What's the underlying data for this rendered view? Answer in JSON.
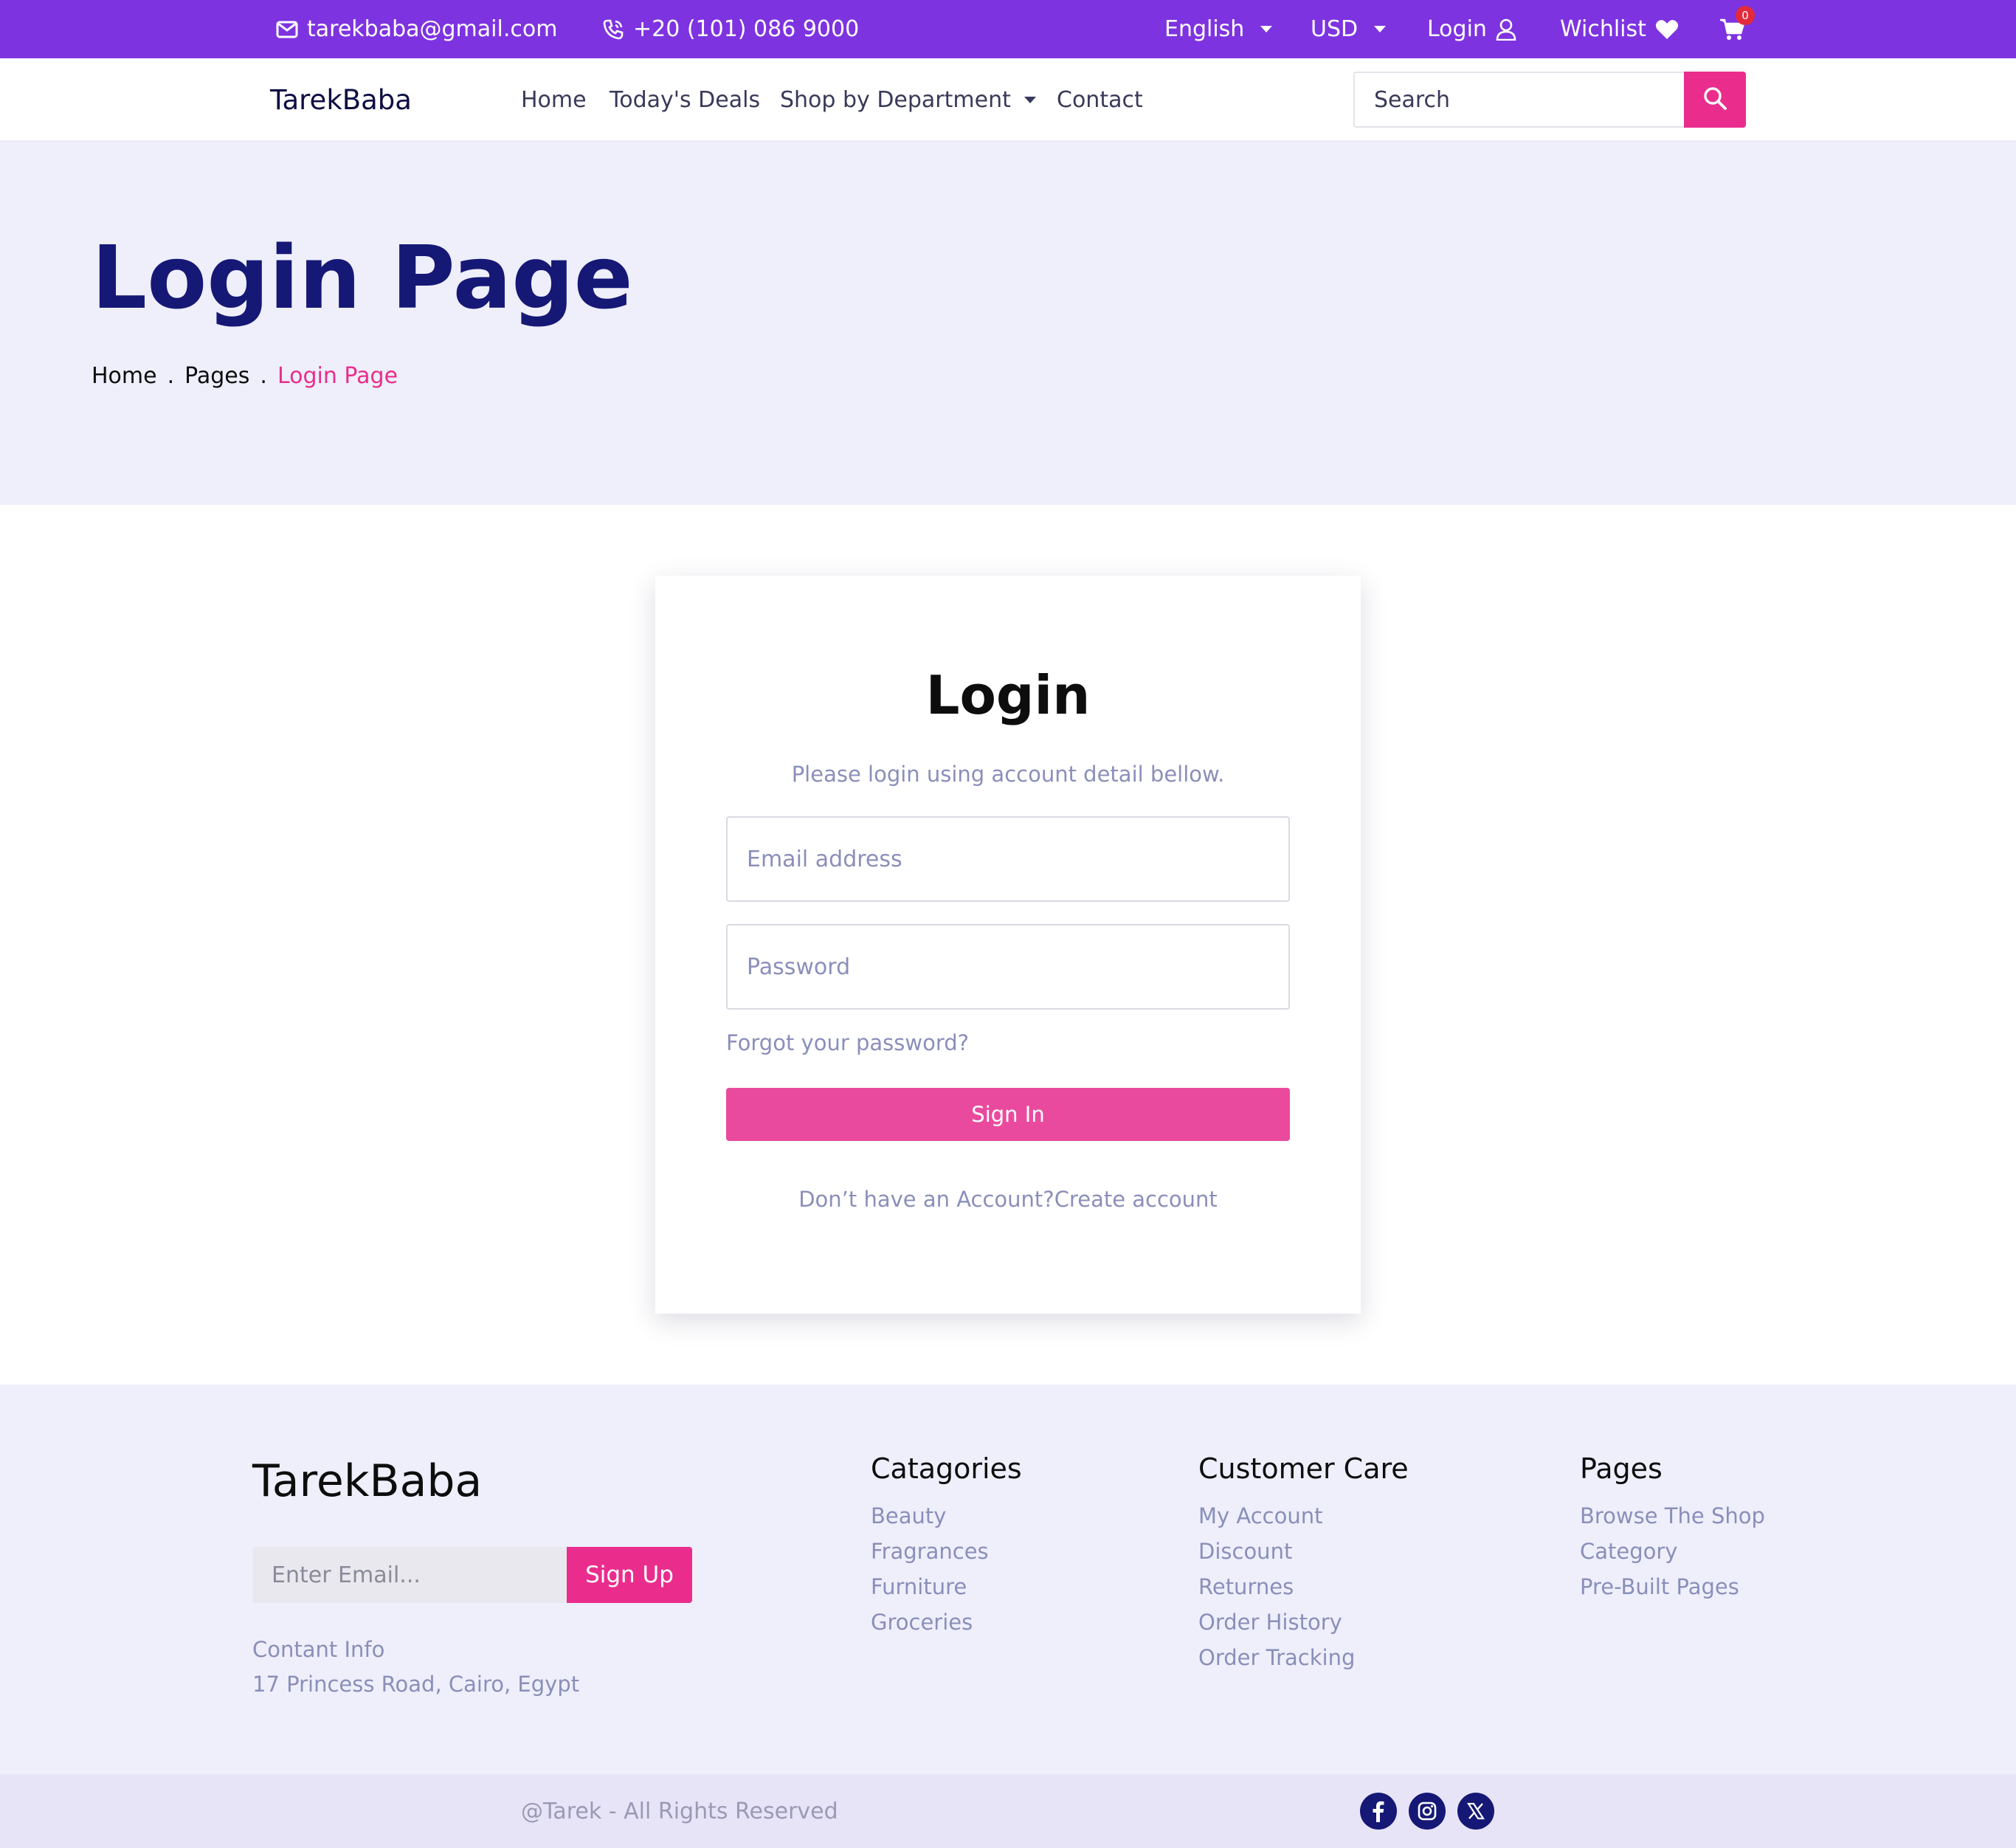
{
  "topbar": {
    "email": "tarekbaba@gmail.com",
    "phone": "+20 (101) 086 9000",
    "language": "English",
    "currency": "USD",
    "login": "Login",
    "wishlist": "Wichlist",
    "cart_count": "0",
    "background": "#7e33e0"
  },
  "nav": {
    "brand": "TarekBaba",
    "links": [
      "Home",
      "Today's Deals",
      "Shop by Department",
      "Contact"
    ],
    "search_placeholder": "Search",
    "accent": "#ea2d8d"
  },
  "hero": {
    "title": "Login Page",
    "breadcrumbs": [
      "Home",
      "Pages",
      "Login Page"
    ],
    "separator": "."
  },
  "login_form": {
    "title": "Login",
    "subtitle": "Please login using account detail bellow.",
    "email_placeholder": "Email address",
    "password_placeholder": "Password",
    "forgot": "Forgot your password?",
    "submit": "Sign In",
    "no_account": "Don’t have an Account?",
    "create": "Create account"
  },
  "footer": {
    "brand": "TarekBaba",
    "newsletter_placeholder": "Enter Email...",
    "newsletter_button": "Sign Up",
    "contact_label": "Contant Info",
    "address": "17 Princess Road, Cairo, Egypt",
    "columns": [
      {
        "heading": "Catagories",
        "links": [
          "Beauty",
          "Fragrances",
          "Furniture",
          "Groceries"
        ]
      },
      {
        "heading": "Customer Care",
        "links": [
          "My Account",
          "Discount",
          "Returnes",
          "Order History",
          "Order Tracking"
        ]
      },
      {
        "heading": "Pages",
        "links": [
          "Browse The Shop",
          "Category",
          "Pre-Built Pages"
        ]
      }
    ],
    "copyright": "@Tarek - All Rights Reserved",
    "social_icons": [
      "facebook-icon",
      "instagram-icon",
      "x-icon"
    ]
  }
}
